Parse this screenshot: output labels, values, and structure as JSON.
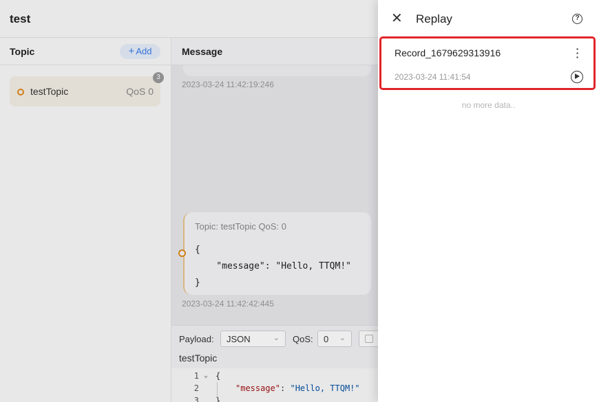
{
  "app": {
    "title": "test",
    "topics_panel": {
      "title": "Topic",
      "add_label": "Add",
      "items": [
        {
          "name": "testTopic",
          "qos": "QoS 0",
          "count": "3",
          "color": "#e08a1e"
        }
      ]
    },
    "messages_panel": {
      "title": "Message",
      "messages": [
        {
          "timestamp": "2023-03-24 11:42:19:246"
        },
        {
          "meta": "Topic: testTopic  QoS: 0",
          "payload": "{\n    \"message\": \"Hello, TTQM!\"\n}",
          "timestamp": "2023-03-24 11:42:42:445"
        }
      ]
    },
    "composer": {
      "payload_label": "Payload:",
      "payload_format": "JSON",
      "qos_label": "QoS:",
      "qos_value": "0",
      "topic": "testTopic",
      "editor": {
        "line_numbers": [
          "1",
          "2",
          "3"
        ],
        "line1": "{",
        "line2_key": "\"message\"",
        "line2_sep": ": ",
        "line2_value": "\"Hello, TTQM!\"",
        "line3": "}"
      }
    }
  },
  "drawer": {
    "title": "Replay",
    "records": [
      {
        "name": "Record_1679629313916",
        "time": "2023-03-24 11:41:54"
      }
    ],
    "empty_text": "no more data..",
    "highlight_color": "#e0242a"
  }
}
